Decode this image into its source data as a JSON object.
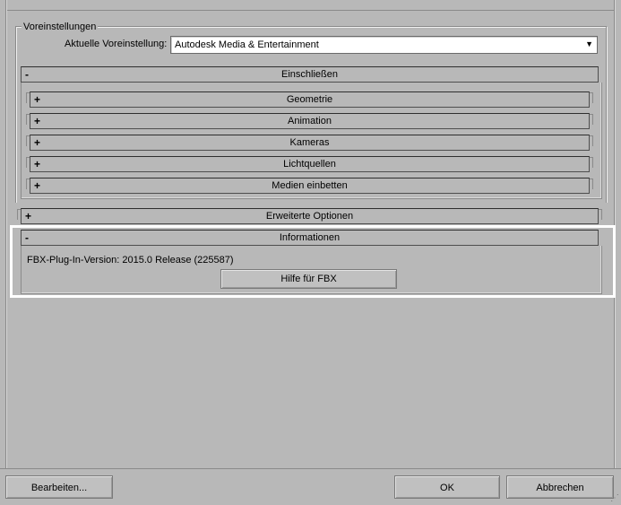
{
  "presets": {
    "group_title": "Voreinstellungen",
    "current_label": "Aktuelle Voreinstellung:",
    "current_value": "Autodesk Media & Entertainment"
  },
  "include": {
    "sign": "-",
    "title": "Einschließen",
    "items": [
      {
        "sign": "+",
        "label": "Geometrie"
      },
      {
        "sign": "+",
        "label": "Animation"
      },
      {
        "sign": "+",
        "label": "Kameras"
      },
      {
        "sign": "+",
        "label": "Lichtquellen"
      },
      {
        "sign": "+",
        "label": "Medien einbetten"
      }
    ]
  },
  "advanced": {
    "sign": "+",
    "title": "Erweiterte Optionen"
  },
  "information": {
    "sign": "-",
    "title": "Informationen",
    "version_text": "FBX-Plug-In-Version: 2015.0 Release (225587)",
    "help_button": "Hilfe für FBX"
  },
  "footer": {
    "edit_button": "Bearbeiten...",
    "ok_button": "OK",
    "cancel_button": "Abbrechen"
  }
}
